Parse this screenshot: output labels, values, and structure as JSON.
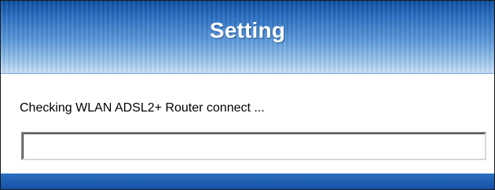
{
  "dialog": {
    "title": "Setting",
    "status_message": "Checking WLAN ADSL2+ Router connect ...",
    "progress": 0
  },
  "colors": {
    "header_top": "#0c4fa0",
    "header_bottom": "#c9e0f6",
    "footer": "#1552a8"
  }
}
